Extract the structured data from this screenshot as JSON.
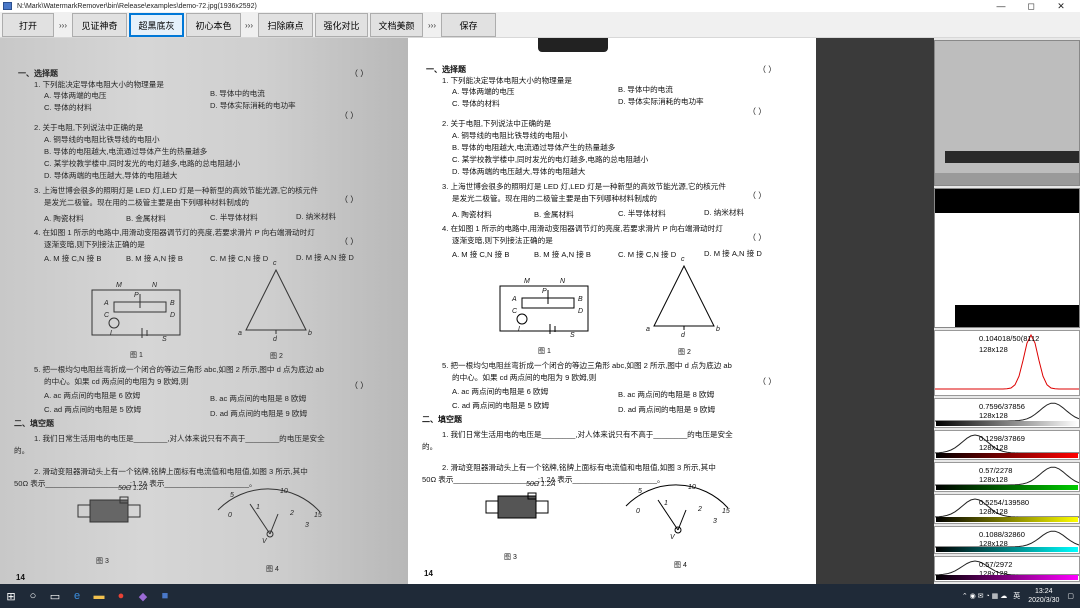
{
  "window": {
    "title": "N:\\Mark\\WatermarkRemover\\bin\\Release\\examples\\demo-72.jpg(1936x2592)",
    "minimize": "—",
    "maximize": "◻",
    "close": "✕"
  },
  "toolbar": {
    "open": "打开",
    "sep1": "›››",
    "show_magic": "见证神奇",
    "ultra_black": "超黑底灰",
    "original": "初心本色",
    "sep2": "›››",
    "despeckle": "扫除麻点",
    "contrast": "强化对比",
    "beautify": "文档美颜",
    "sep3": "›››",
    "save": "保存"
  },
  "doc": {
    "sec1": "一、选择题",
    "paren": "（    ）",
    "q1": "1. 下列能决定导体电阻大小的物理量是",
    "q1a": "A. 导体两端的电压",
    "q1b": "B. 导体中的电流",
    "q1c": "C. 导体的材料",
    "q1d": "D. 导体实际消耗的电功率",
    "q2": "2. 关于电阻,下列说法中正确的是",
    "q2a": "A. 铜导线的电阻比铁导线的电阻小",
    "q2b": "B. 导体的电阻越大,电流通过导体产生的热量越多",
    "q2c": "C. 某学校教学楼中,同时发光的电灯越多,电路的总电阻越小",
    "q2d": "D. 导体两端的电压越大,导体的电阻越大",
    "q3": "3. 上海世博会很多的照明灯是 LED 灯,LED 灯是一种新型的高效节能光源,它的核元件",
    "q3b": "是发光二极管。现在用的二极管主要是由下列哪种材料制成的",
    "q3o1": "A. 陶瓷材料",
    "q3o2": "B. 金属材料",
    "q3o3": "C. 半导体材料",
    "q3o4": "D. 纳米材料",
    "q4": "4. 在如图 1 所示的电路中,用滑动变阻器调节灯的亮度,若要求滑片 P 向右端滑动时灯",
    "q4b": "逐渐变暗,则下列接法正确的是",
    "q4o1": "A. M 接 C,N 接 B",
    "q4o2": "B. M 接 A,N 接 B",
    "q4o3": "C. M 接 C,N 接 D",
    "q4o4": "D. M 接 A,N 接 D",
    "fig1": "图 1",
    "fig2": "图 2",
    "q5": "5. 把一根均匀电阻丝弯折成一个闭合的等边三角形 abc,如图 2 所示,图中 d 点为底边 ab",
    "q5b": "的中心。如果 cd 两点间的电阻为 9 欧姆,则",
    "q5a": "A. ac 两点间的电阻是 6 欧姆",
    "q5bb": "B. ac 两点间的电阻是 8 欧姆",
    "q5c": "C. ad 两点间的电阻是 5 欧姆",
    "q5d": "D. ad 两点间的电阻是 9 欧姆",
    "sec2": "二、填空题",
    "f1": "1. 我们日常生活用电的电压是________,对人体来说只有不高于________的电压是安全",
    "f1b": "的。",
    "f2": "2. 滑动变阻器滑动头上有一个铭牌,铭牌上面标有电流值和电阻值,如图 3 所示,其中",
    "f2b": "50Ω 表示____________________;1.2A 表示____________________。",
    "rheo": "50Ω 1.2A",
    "fig3": "图 3",
    "fig4": "图 4",
    "page": "14",
    "lblM": "M",
    "lblN": "N",
    "lblA": "A",
    "lblB": "B",
    "lblC": "C",
    "lblD": "D",
    "lblP": "P",
    "lblL": "L",
    "lblS": "S",
    "tc": "c",
    "ta": "a",
    "tb": "b",
    "td": "d",
    "m5": "5",
    "m10": "10",
    "m15": "15",
    "m0": "0",
    "m1": "1",
    "m2": "2",
    "m3": "3",
    "mV": "V"
  },
  "histograms": [
    {
      "label": "0.104018/50(8112",
      "size": "128x128",
      "color": "#c00000"
    },
    {
      "label": "0.7596/37856",
      "size": "128x128",
      "color": "#ffffff"
    },
    {
      "label": "0.1298/37869",
      "size": "128x128",
      "color": "#ff0000"
    },
    {
      "label": "0.57/2278",
      "size": "128x128",
      "color": "#00cc00"
    },
    {
      "label": "0.5254/139580",
      "size": "128x128",
      "color": "#ffff00"
    },
    {
      "label": "0.1088/32860",
      "size": "128x128",
      "color": "#00ffff"
    },
    {
      "label": "0.57/2972",
      "size": "128x128",
      "color": "#ff00ff"
    }
  ],
  "taskbar": {
    "time": "13:24",
    "date": "2020/3/30",
    "lang": "英",
    "badge": "2"
  }
}
